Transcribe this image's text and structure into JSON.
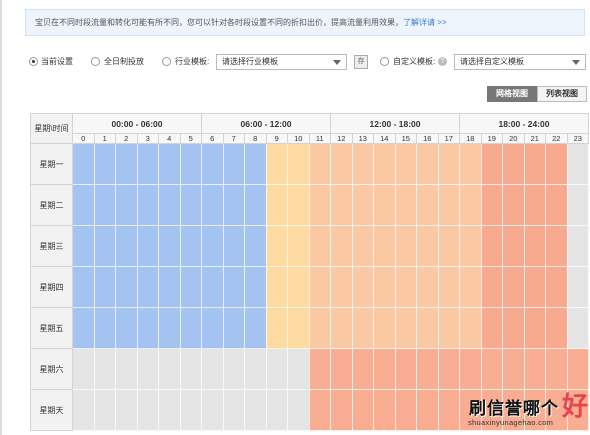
{
  "notice": {
    "text": "宝贝在不同时段流量和转化可能有所不同，您可以针对各时段设置不同的折扣出价，提高流量利用效果，",
    "link": "了解详请 >>"
  },
  "options": {
    "current_label": "当前设置",
    "allday_label": "全日制投放",
    "industry_label": "行业模板:",
    "industry_select": "请选择行业模板",
    "fav_icon_text": "存",
    "custom_label": "自定义模板:",
    "custom_help": "?",
    "custom_select": "请选择自定义模板",
    "selected": "current"
  },
  "view_tabs": {
    "grid_label": "网格视图",
    "list_label": "列表视图",
    "active": "grid"
  },
  "schedule": {
    "corner_label": "星期\\时间",
    "ranges": [
      "00:00 - 06:00",
      "06:00 - 12:00",
      "12:00 - 18:00",
      "18:00 - 24:00"
    ],
    "hours": [
      "0",
      "1",
      "2",
      "3",
      "4",
      "5",
      "6",
      "7",
      "8",
      "9",
      "10",
      "11",
      "12",
      "13",
      "14",
      "15",
      "16",
      "17",
      "18",
      "19",
      "20",
      "21",
      "22",
      "23"
    ],
    "days": [
      {
        "name": "星期一",
        "levels": [
          "B",
          "B",
          "B",
          "B",
          "B",
          "B",
          "B",
          "B",
          "B",
          "Y",
          "Y",
          "L",
          "L",
          "L",
          "L",
          "L",
          "L",
          "L",
          "L",
          "D",
          "D",
          "D",
          "D",
          "G"
        ]
      },
      {
        "name": "星期二",
        "levels": [
          "B",
          "B",
          "B",
          "B",
          "B",
          "B",
          "B",
          "B",
          "B",
          "Y",
          "Y",
          "L",
          "L",
          "L",
          "L",
          "L",
          "L",
          "L",
          "L",
          "D",
          "D",
          "D",
          "D",
          "G"
        ]
      },
      {
        "name": "星期三",
        "levels": [
          "B",
          "B",
          "B",
          "B",
          "B",
          "B",
          "B",
          "B",
          "B",
          "Y",
          "Y",
          "L",
          "L",
          "L",
          "L",
          "L",
          "L",
          "L",
          "L",
          "D",
          "D",
          "D",
          "D",
          "G"
        ]
      },
      {
        "name": "星期四",
        "levels": [
          "B",
          "B",
          "B",
          "B",
          "B",
          "B",
          "B",
          "B",
          "B",
          "Y",
          "Y",
          "L",
          "L",
          "L",
          "L",
          "L",
          "L",
          "L",
          "L",
          "D",
          "D",
          "D",
          "D",
          "G"
        ]
      },
      {
        "name": "星期五",
        "levels": [
          "B",
          "B",
          "B",
          "B",
          "B",
          "B",
          "B",
          "B",
          "B",
          "Y",
          "Y",
          "L",
          "L",
          "L",
          "L",
          "L",
          "L",
          "L",
          "L",
          "D",
          "D",
          "D",
          "D",
          "G"
        ]
      },
      {
        "name": "星期六",
        "levels": [
          "G",
          "G",
          "G",
          "G",
          "G",
          "G",
          "G",
          "G",
          "G",
          "G",
          "G",
          "S",
          "S",
          "S",
          "S",
          "S",
          "S",
          "S",
          "S",
          "S",
          "S",
          "S",
          "S",
          "S"
        ]
      },
      {
        "name": "星期天",
        "levels": [
          "G",
          "G",
          "G",
          "G",
          "G",
          "G",
          "G",
          "G",
          "G",
          "G",
          "G",
          "S",
          "S",
          "S",
          "S",
          "S",
          "S",
          "S",
          "S",
          "S",
          "S",
          "S",
          "S",
          "S"
        ]
      }
    ],
    "colors": {
      "B": "#a4c3f1",
      "Y": "#fddaa0",
      "L": "#fbc8a4",
      "D": "#f8aa8f",
      "S": "#f9ae94",
      "G": "#e5e5e5"
    }
  },
  "watermark": {
    "text": "刷信誉哪个",
    "big": "好",
    "url": "shuaxinyunagehao.com"
  }
}
